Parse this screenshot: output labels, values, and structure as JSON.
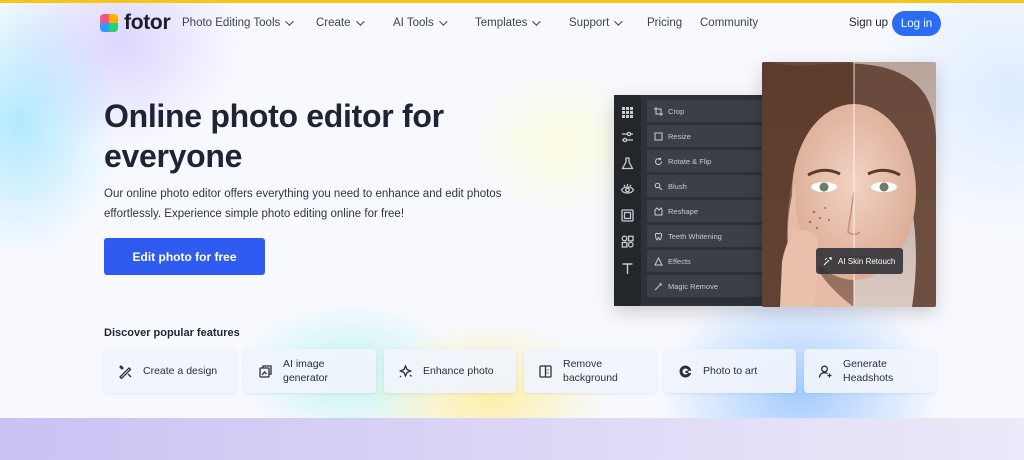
{
  "brand": {
    "name": "fotor"
  },
  "nav": {
    "items": [
      {
        "label": "Photo Editing Tools",
        "dropdown": true
      },
      {
        "label": "Create",
        "dropdown": true
      },
      {
        "label": "AI Tools",
        "dropdown": true
      },
      {
        "label": "Templates",
        "dropdown": true
      },
      {
        "label": "Support",
        "dropdown": true
      },
      {
        "label": "Pricing",
        "dropdown": false
      },
      {
        "label": "Community",
        "dropdown": false
      }
    ],
    "signup": "Sign up",
    "login": "Log in"
  },
  "hero": {
    "headline": "Online photo editor for everyone",
    "subcopy": "Our online photo editor offers everything you need to enhance and edit photos effortlessly. Experience simple photo editing online for free!",
    "cta": "Edit photo for free"
  },
  "editor": {
    "tools": [
      "Crop",
      "Resize",
      "Rotate & Flip",
      "Blush",
      "Reshape",
      "Teeth Whitening",
      "Effects",
      "Magic Remove"
    ],
    "strip_icons": [
      "grid-icon",
      "sliders-icon",
      "flask-icon",
      "eye-icon",
      "frame-icon",
      "shapes-icon",
      "text-icon"
    ],
    "badge": "AI Skin Retouch"
  },
  "features": {
    "title": "Discover popular features",
    "items": [
      {
        "label": "Create a design",
        "icon": "design-tools-icon"
      },
      {
        "label": "AI image generator",
        "icon": "ai-image-icon"
      },
      {
        "label": "Enhance photo",
        "icon": "enhance-icon"
      },
      {
        "label": "Remove background",
        "icon": "remove-bg-icon"
      },
      {
        "label": "Photo to art",
        "icon": "art-icon"
      },
      {
        "label": "Generate Headshots",
        "icon": "headshot-icon"
      }
    ]
  },
  "colors": {
    "accent": "#2f5bf0",
    "login_bg": "#2a6cf6",
    "top_line": "#f5c518",
    "editor_bg": "#2e3137"
  }
}
